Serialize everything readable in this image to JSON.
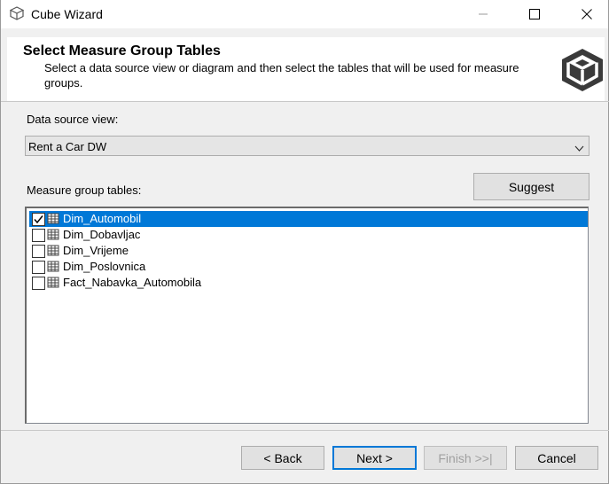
{
  "window": {
    "title": "Cube Wizard",
    "app_icon": "cube-icon",
    "controls": [
      "minimize-icon",
      "maximize-icon",
      "close-icon"
    ]
  },
  "header": {
    "title": "Select Measure Group Tables",
    "description": "Select a data source view or diagram and then select the tables that will be used for measure groups.",
    "logo": "cube-logo-icon"
  },
  "dsv": {
    "label": "Data source view:",
    "selected": "Rent a Car DW"
  },
  "measure_tables": {
    "label": "Measure group tables:",
    "suggest_label": "Suggest",
    "items": [
      {
        "name": "Dim_Automobil",
        "checked": true,
        "selected": true
      },
      {
        "name": "Dim_Dobavljac",
        "checked": false,
        "selected": false
      },
      {
        "name": "Dim_Vrijeme",
        "checked": false,
        "selected": false
      },
      {
        "name": "Dim_Poslovnica",
        "checked": false,
        "selected": false
      },
      {
        "name": "Fact_Nabavka_Automobila",
        "checked": false,
        "selected": false
      }
    ]
  },
  "footer": {
    "back_label": "< Back",
    "next_label": "Next >",
    "finish_label": "Finish >>|",
    "cancel_label": "Cancel"
  },
  "colors": {
    "selection": "#0078d7",
    "default_button_border": "#0078d7"
  }
}
